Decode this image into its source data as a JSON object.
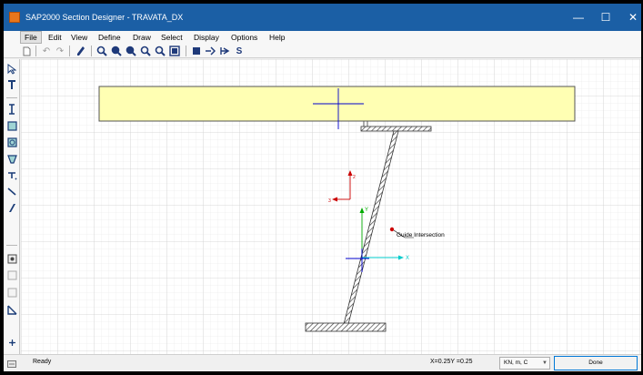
{
  "window": {
    "title": "SAP2000 Section Designer - TRAVATA_DX",
    "minimize_glyph": "—",
    "maximize_glyph": "☐",
    "close_glyph": "✕"
  },
  "menu": [
    "File",
    "Edit",
    "View",
    "Define",
    "Draw",
    "Select",
    "Display",
    "Options",
    "Help"
  ],
  "toolbar": {
    "set_label": "S"
  },
  "canvas": {
    "guide_label": "Guide Intersection",
    "axis_y": "Y",
    "axis_x": "X"
  },
  "status": {
    "text": "Ready",
    "coords": "X=0.25Y =0.25",
    "units": "KN, m, C",
    "done": "Done"
  },
  "colors": {
    "titlebar": "#1b5fa5",
    "slab_fill": "#ffffb3",
    "guide_axes": "#0000cc",
    "local_axes": "#cc0000",
    "global_y": "#00aa00",
    "global_x": "#00cccc"
  }
}
